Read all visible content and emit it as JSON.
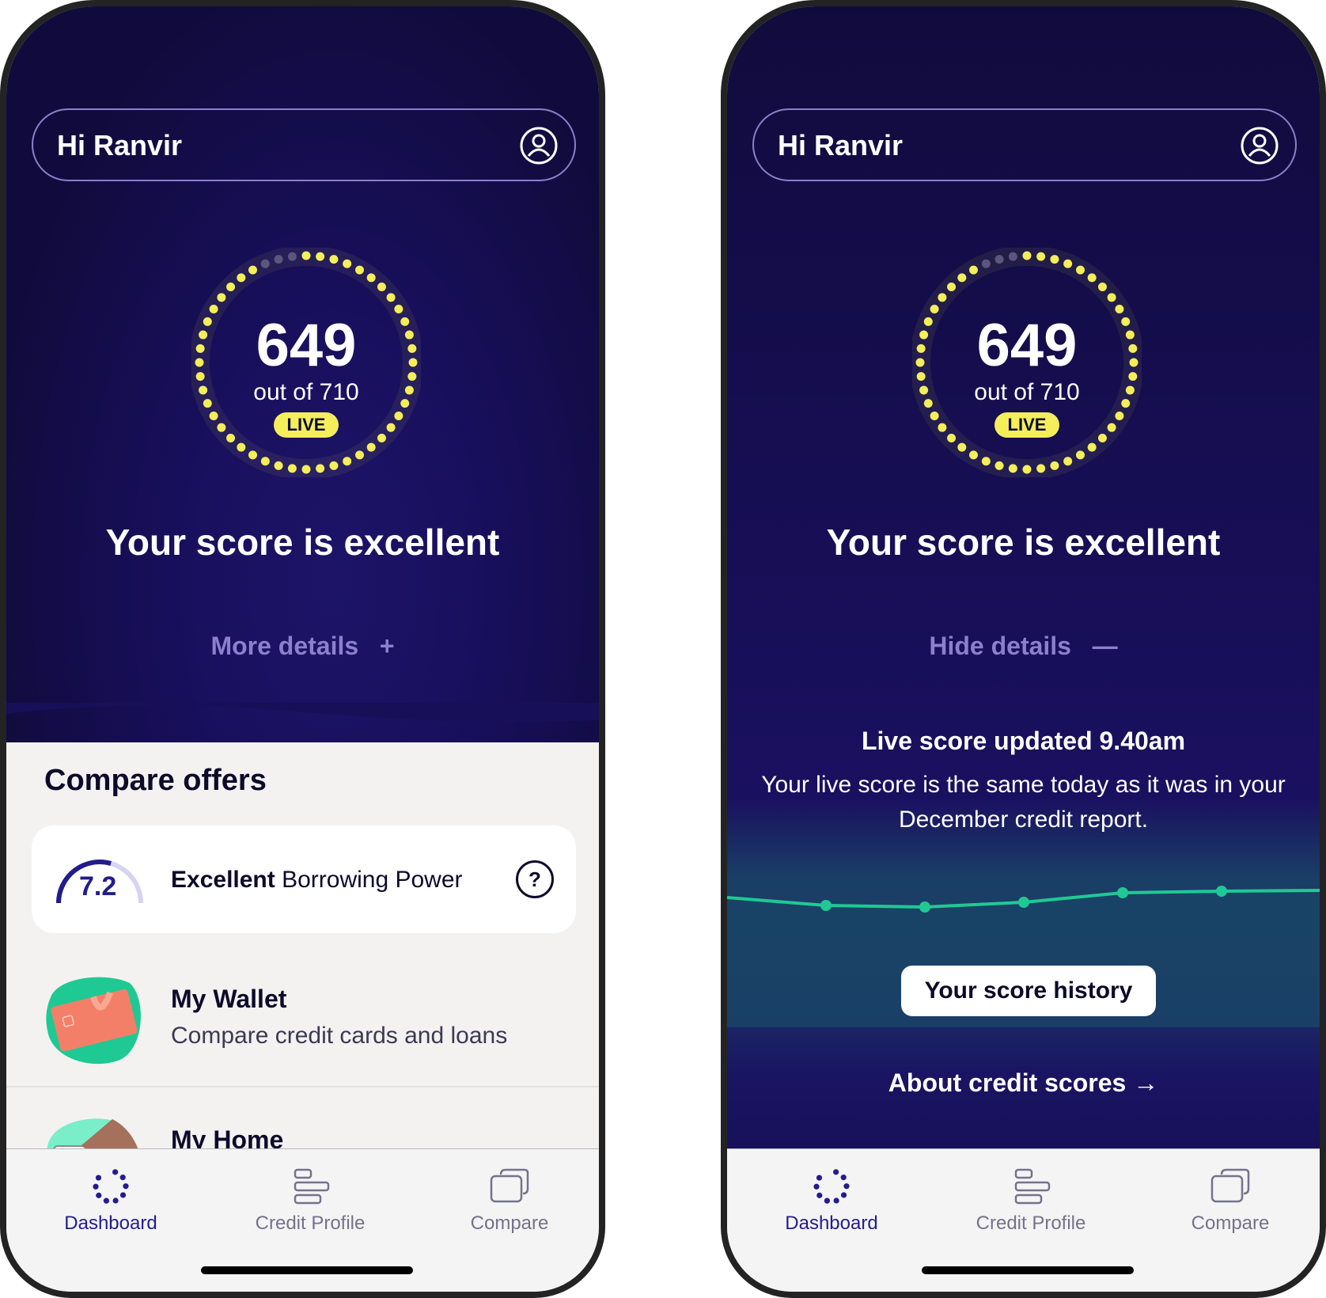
{
  "screens": {
    "left": {
      "greeting": "Hi Ranvir",
      "score": "649",
      "score_out_of": "out of 710",
      "live_badge": "LIVE",
      "score_rating": "Your score is excellent",
      "details_toggle": "More details",
      "details_toggle_icon": "plus-icon",
      "compare_title": "Compare offers",
      "borrowing_power": {
        "value": "7.2",
        "gauge_fraction": 0.72,
        "rating": "Excellent",
        "label": "Borrowing Power",
        "help_icon": "question-icon"
      },
      "list": [
        {
          "title": "My Wallet",
          "subtitle": "Compare credit cards and loans"
        },
        {
          "title": "My Home",
          "subtitle": ""
        }
      ]
    },
    "right": {
      "greeting": "Hi Ranvir",
      "score": "649",
      "score_out_of": "out of 710",
      "live_badge": "LIVE",
      "score_rating": "Your score is excellent",
      "details_toggle": "Hide details",
      "details_toggle_icon": "minus-icon",
      "live_updated": "Live score updated 9.40am",
      "live_description": "Your live score is the same today as it was in your December credit report.",
      "history_button": "Your score history",
      "about_link": "About credit scores"
    }
  },
  "score_gauge": {
    "score": 649,
    "max": 710,
    "dots_total": 48,
    "dots_inactive": 3,
    "active_color": "#f4ee5a",
    "inactive_color": "#5a5680"
  },
  "trend_chart": {
    "type": "line",
    "points_relative": [
      0.35,
      0.3,
      0.45,
      0.75,
      0.8
    ],
    "line_color": "#1fc994"
  },
  "tabbar": {
    "tabs": [
      {
        "label": "Dashboard",
        "icon": "dashboard-dots-icon",
        "active": true
      },
      {
        "label": "Credit Profile",
        "icon": "credit-profile-icon",
        "active": false
      },
      {
        "label": "Compare",
        "icon": "compare-cards-icon",
        "active": false
      }
    ]
  },
  "colors": {
    "navy": "#110b3d",
    "accent": "#231c8c",
    "yellow": "#f4ee5a",
    "green": "#1fc994",
    "muted_purple": "#8a80cc"
  }
}
